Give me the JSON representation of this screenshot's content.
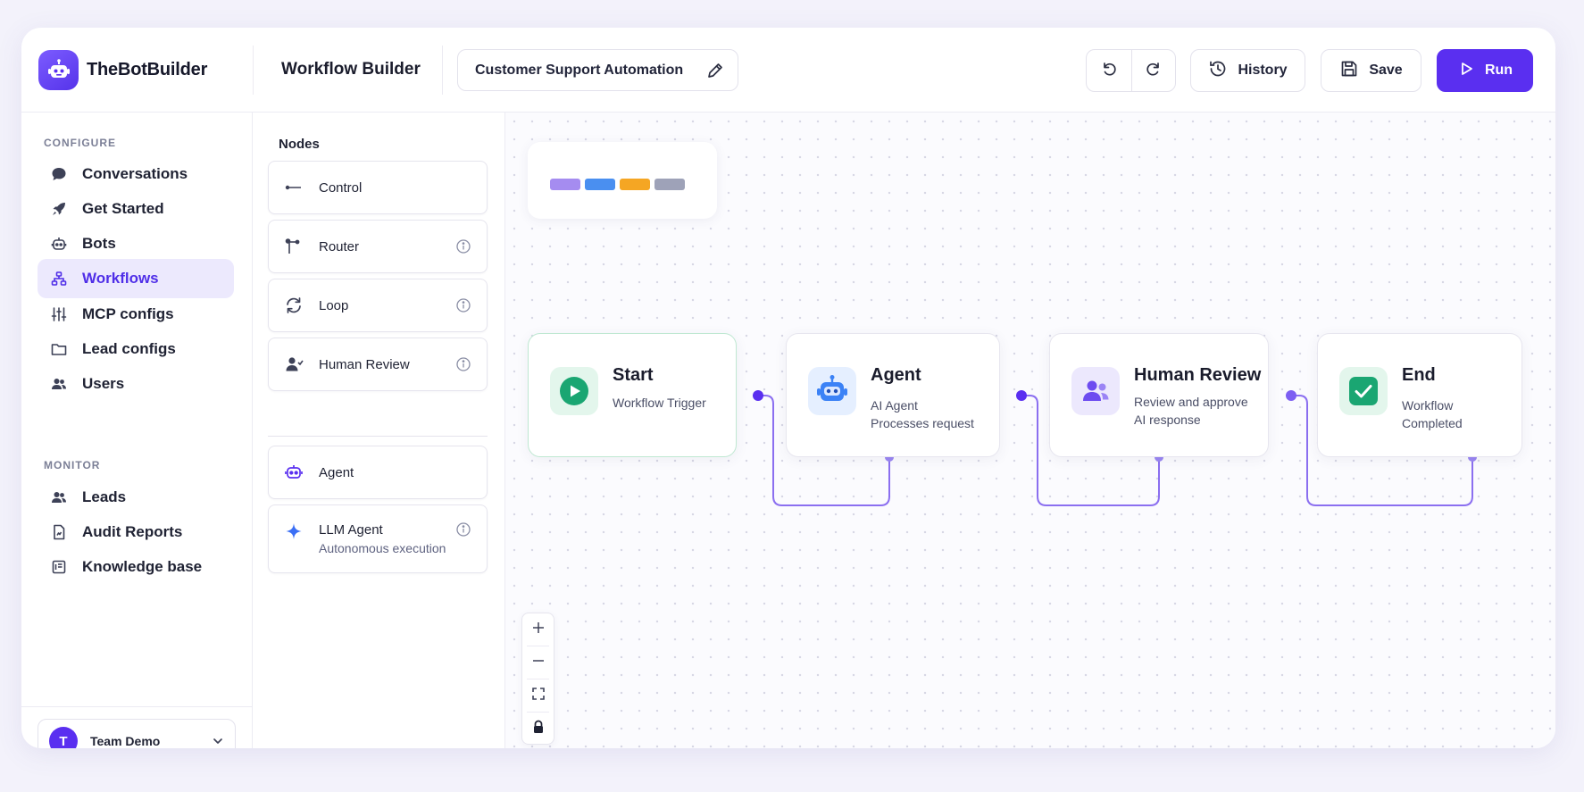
{
  "brand": {
    "name": "TheBotBuilder"
  },
  "header": {
    "title": "Workflow Builder",
    "workflow_name": "Customer Support Automation",
    "history_label": "History",
    "save_label": "Save",
    "run_label": "Run"
  },
  "sidebar": {
    "configure_label": "CONFIGURE",
    "configure_items": [
      {
        "label": "Conversations",
        "icon": "chat-bubble-icon"
      },
      {
        "label": "Get Started",
        "icon": "rocket-icon"
      },
      {
        "label": "Bots",
        "icon": "bot-icon"
      },
      {
        "label": "Workflows",
        "icon": "workflow-icon",
        "active": true
      },
      {
        "label": "MCP configs",
        "icon": "sliders-icon"
      },
      {
        "label": "Lead configs",
        "icon": "folder-icon"
      },
      {
        "label": "Users",
        "icon": "users-icon"
      }
    ],
    "monitor_label": "MONITOR",
    "monitor_items": [
      {
        "label": "Leads",
        "icon": "users-icon"
      },
      {
        "label": "Audit Reports",
        "icon": "report-icon"
      },
      {
        "label": "Knowledge base",
        "icon": "book-icon"
      }
    ],
    "team": {
      "initial": "T",
      "name": "Team Demo"
    }
  },
  "nodes_panel": {
    "title": "Nodes",
    "items": [
      {
        "label": "Control",
        "icon": "control-icon"
      },
      {
        "label": "Router",
        "icon": "router-icon"
      },
      {
        "label": "Loop",
        "icon": "loop-icon"
      },
      {
        "label": "Human Review",
        "icon": "person-icon"
      },
      {
        "label": "Agent",
        "icon": "robot-icon"
      },
      {
        "label": "LLM Agent",
        "sublabel": "Autonomous execution",
        "icon": "sparkle-icon"
      }
    ]
  },
  "canvas": {
    "legend_colors": [
      "#a58cf0",
      "#4a8ff0",
      "#f5a623",
      "#9ea2b8"
    ],
    "flow_nodes": [
      {
        "title": "Start",
        "line1": "Workflow Trigger",
        "line2": "",
        "accent": "#1aa672"
      },
      {
        "title": "Agent",
        "line1": "AI Agent",
        "line2": "Processes request",
        "accent": "#3b82f6"
      },
      {
        "title": "Human Review",
        "line1": "Review and approve",
        "line2": "AI response",
        "accent": "#6d4cf0"
      },
      {
        "title": "End",
        "line1": "Workflow",
        "line2": "Completed",
        "accent": "#1aa672"
      }
    ]
  },
  "colors": {
    "accent": "#5a2ff0",
    "success": "#1aa672"
  }
}
